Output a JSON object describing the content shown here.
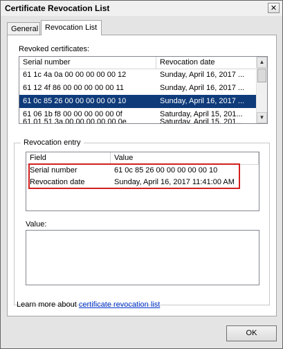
{
  "window": {
    "title": "Certificate Revocation List",
    "close_glyph": "✕"
  },
  "tabs": [
    {
      "label": "General"
    },
    {
      "label": "Revocation List"
    }
  ],
  "revoked": {
    "label": "Revoked certificates:",
    "columns": [
      "Serial number",
      "Revocation date"
    ],
    "rows": [
      {
        "serial": "61 1c 4a 0a 00 00 00 00 00 12",
        "date": "Sunday, April 16, 2017 ..."
      },
      {
        "serial": "61 12 4f 86 00 00 00 00 00 11",
        "date": "Sunday, April 16, 2017 ..."
      },
      {
        "serial": "61 0c 85 26 00 00 00 00 00 10",
        "date": "Sunday, April 16, 2017 ..."
      },
      {
        "serial": "61 06 1b f8 00 00 00 00 00 0f",
        "date": "Saturday, April 15, 201..."
      },
      {
        "serial": "61 01 51 3a 00 00 00 00 00 0e",
        "date": "Saturday, April 15, 201..."
      }
    ],
    "selected_index": 2
  },
  "entry": {
    "group_label": "Revocation entry",
    "columns": [
      "Field",
      "Value"
    ],
    "rows": [
      {
        "field": "Serial number",
        "value": "61 0c 85 26 00 00 00 00 00 10"
      },
      {
        "field": "Revocation date",
        "value": "Sunday, April 16, 2017 11:41:00 AM"
      }
    ],
    "value_label": "Value:"
  },
  "footer": {
    "learn_prefix": "Learn more about ",
    "learn_link": "certificate revocation list",
    "ok_label": "OK"
  },
  "icons": {
    "scroll_up": "up-arrow",
    "scroll_down": "down-arrow"
  },
  "colors": {
    "selection": "#0f3b7a",
    "highlight": "#d0201f",
    "link": "#0033cc"
  }
}
